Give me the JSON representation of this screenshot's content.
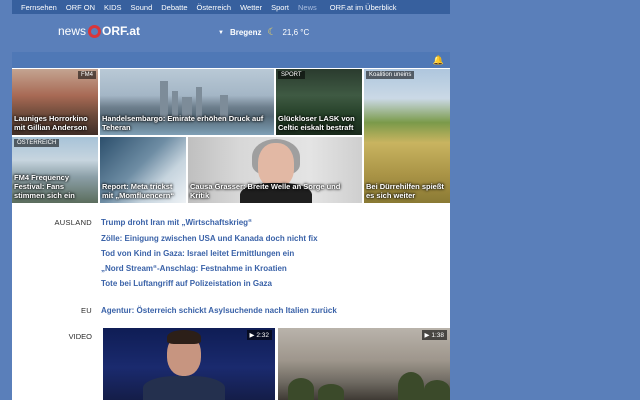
{
  "topnav": {
    "items": [
      "Fernsehen",
      "ORF ON",
      "KIDS",
      "Sound",
      "Debatte",
      "Österreich",
      "Wetter",
      "Sport",
      "News"
    ],
    "active": "News",
    "right_link": "ORF.at im Überblick"
  },
  "header": {
    "logo_news": "news",
    "logo_brand": "ORF.at",
    "weather_city": "Bregenz",
    "weather_temp": "21,6 °C",
    "weather_icon": "moon-icon"
  },
  "tiles": [
    {
      "caption": "Launiges Horrorkino mit Gillian Anderson",
      "tag": "FM4"
    },
    {
      "caption": "Handelsembargo: Emirate erhöhen Druck auf Teheran",
      "tag": ""
    },
    {
      "caption": "Glückloser LASK von Celtic eiskalt bestraft",
      "tag": "SPORT"
    },
    {
      "caption": "Bei Dürrehilfen spießt es sich weiter",
      "tag": "Koalition uneins"
    },
    {
      "caption": "FM4 Frequency Festival: Fans stimmen sich ein",
      "tag": "ÖSTERREICH"
    },
    {
      "caption": "Report: Meta trickst mit „Momfluencern“",
      "tag": ""
    },
    {
      "caption": "Causa Grasser: Breite Welle an Sorge und Kritik",
      "tag": ""
    }
  ],
  "sections": {
    "ausland": {
      "label": "AUSLAND",
      "items": [
        "Trump droht Iran mit „Wirtschaftskrieg“",
        "Zölle: Einigung zwischen USA und Kanada doch nicht fix",
        "Tod von Kind in Gaza: Israel leitet Ermittlungen ein",
        "„Nord Stream“-Anschlag: Festnahme in Kroatien",
        "Tote bei Luftangriff auf Polizeistation in Gaza"
      ]
    },
    "eu": {
      "label": "EU",
      "items": [
        "Agentur: Österreich schickt Asylsuchende nach Italien zurück"
      ]
    },
    "video": {
      "label": "VIDEO",
      "items": [
        {
          "duration": "▶ 2:32"
        },
        {
          "duration": "▶ 1:38"
        }
      ]
    }
  },
  "colors": {
    "page_bg": "#5a7fba",
    "nav_bg": "#37609e",
    "link": "#3a62a8",
    "logo_red": "#d9363a"
  }
}
